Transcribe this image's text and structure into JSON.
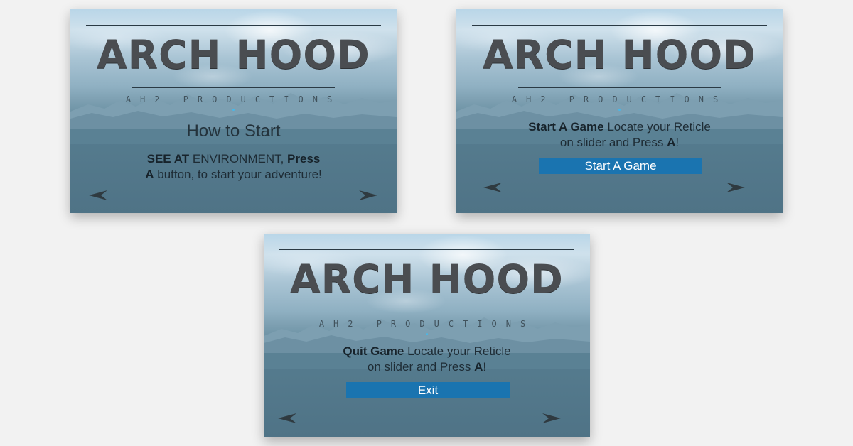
{
  "logo": {
    "title": "ARCH HOOD",
    "subtitle": "AH2 PRODUCTIONS"
  },
  "screens": [
    {
      "heading": "How to Start",
      "line1_bold": "SEE AT",
      "line1_rest": " ENVIRONMENT, ",
      "line1_bold2": "Press",
      "line2_bold": "A",
      "line2_rest": " button, to start your adventure!"
    },
    {
      "action_bold": "Start A Game",
      "action_rest": " Locate your Reticle",
      "line2_pre": "on slider and Press ",
      "line2_bold": "A",
      "line2_post": "!",
      "button": "Start A Game"
    },
    {
      "action_bold": "Quit Game",
      "action_rest": " Locate your Reticle",
      "line2_pre": "on slider and Press ",
      "line2_bold": "A",
      "line2_post": "!",
      "button": "Exit"
    }
  ],
  "icons": {
    "prev": "arrow-left-icon",
    "next": "arrow-right-icon"
  },
  "colors": {
    "button": "#1a74b0",
    "reticle_dot": "#49b8e8",
    "logo": "#4a4d51"
  }
}
